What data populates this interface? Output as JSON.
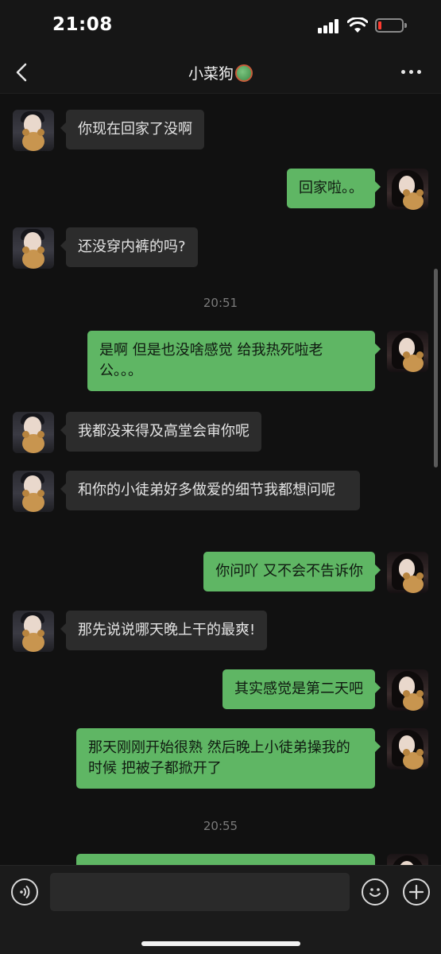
{
  "status_bar": {
    "time": "21:08"
  },
  "nav": {
    "title": "小菜狗"
  },
  "messages": [
    {
      "dir": "in",
      "text": "你现在回家了没啊"
    },
    {
      "dir": "out",
      "text": "回家啦。。"
    },
    {
      "dir": "in",
      "text": "还没穿内裤的吗?"
    },
    {
      "dir": "out",
      "text": "是啊 但是也没啥感觉 给我热死啦老公。。。"
    },
    {
      "dir": "in",
      "text": "我都没来得及高堂会审你呢"
    },
    {
      "dir": "in",
      "text": "和你的小徒弟好多做爱的细节我都想问呢"
    },
    {
      "dir": "out",
      "text": "你问吖 又不会不告诉你"
    },
    {
      "dir": "in",
      "text": "那先说说哪天晚上干的最爽!"
    },
    {
      "dir": "out",
      "text": "其实感觉是第二天吧"
    },
    {
      "dir": "out",
      "text": "那天刚刚开始很熟 然后晚上小徒弟操我的时候 把被子都掀开了"
    },
    {
      "dir": "out",
      "text": ""
    }
  ],
  "timestamps": [
    "20:51",
    "20:55"
  ],
  "input": {
    "value": ""
  },
  "colors": {
    "incoming_bubble": "#2c2c2c",
    "outgoing_bubble": "#5fb664",
    "background": "#111111"
  }
}
